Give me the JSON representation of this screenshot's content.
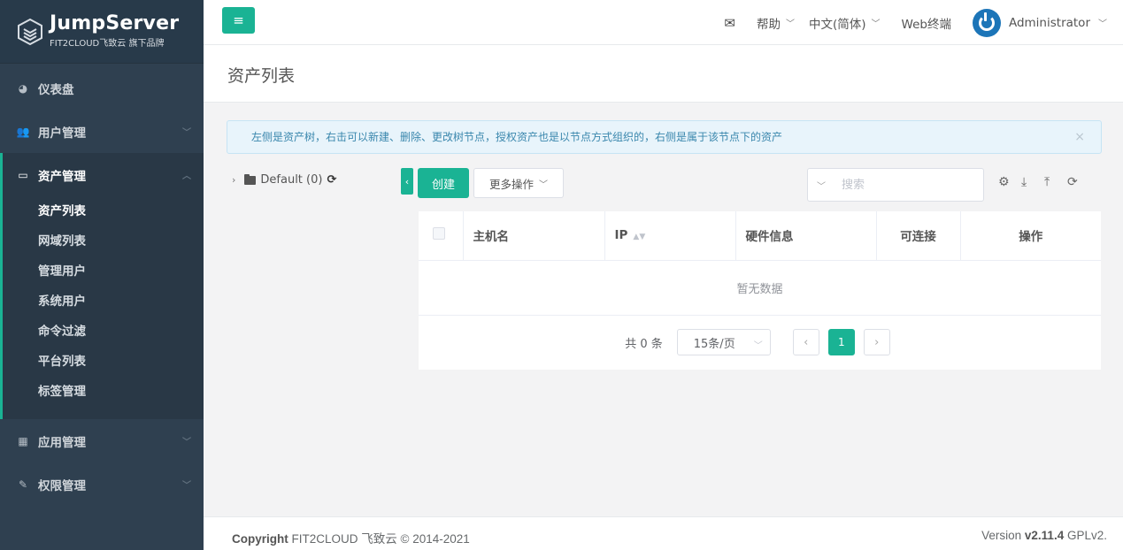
{
  "logo": {
    "title": "JumpServer",
    "subtitle": "FIT2CLOUD飞致云 旗下品牌"
  },
  "sidebar": {
    "items": [
      {
        "label": "仪表盘",
        "icon": "dashboard-icon"
      },
      {
        "label": "用户管理",
        "icon": "users-icon"
      },
      {
        "label": "资产管理",
        "icon": "inbox-icon",
        "children": [
          "资产列表",
          "网域列表",
          "管理用户",
          "系统用户",
          "命令过滤",
          "平台列表",
          "标签管理"
        ]
      },
      {
        "label": "应用管理",
        "icon": "grid-icon"
      },
      {
        "label": "权限管理",
        "icon": "edit-icon"
      }
    ]
  },
  "topbar": {
    "help": "帮助",
    "language": "中文(简体)",
    "web_terminal": "Web终端",
    "user": "Administrator"
  },
  "page": {
    "title": "资产列表"
  },
  "alert": {
    "text": "左侧是资产树，右击可以新建、删除、更改树节点，授权资产也是以节点方式组织的，右侧是属于该节点下的资产",
    "close": "×"
  },
  "tree": {
    "root": "Default (0)"
  },
  "toolbar": {
    "create": "创建",
    "more": "更多操作",
    "search_placeholder": "搜索"
  },
  "table": {
    "columns": [
      "主机名",
      "IP",
      "硬件信息",
      "可连接",
      "操作"
    ],
    "empty_text": "暂无数据"
  },
  "pagination": {
    "total": "共 0 条",
    "page_size": "15条/页",
    "current_page": "1"
  },
  "footer": {
    "copyright_label": "Copyright",
    "copyright_text": "FIT2CLOUD 飞致云 © 2014-2021",
    "version_label": "Version",
    "version": "v2.11.4",
    "license": "GPLv2."
  },
  "colors": {
    "accent": "#1ab394",
    "sidebar": "#2f4050",
    "alert_bg": "#e8f4fb"
  }
}
